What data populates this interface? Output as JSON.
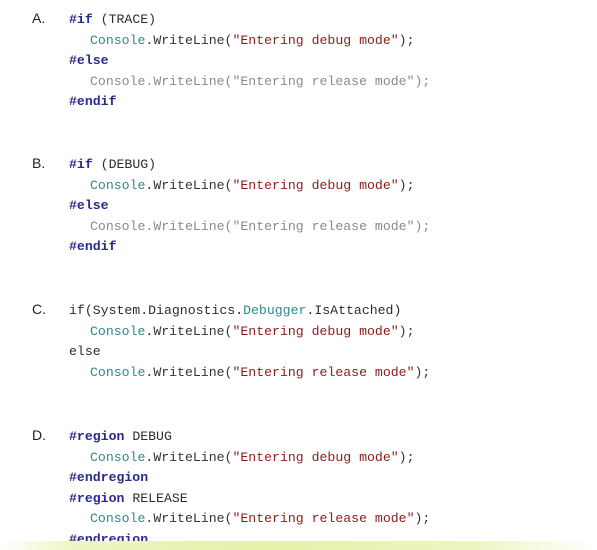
{
  "options": [
    {
      "letter": "A.",
      "lines": [
        {
          "indent": false,
          "parts": [
            {
              "t": "#if",
              "c": "dir"
            },
            {
              "t": " (TRACE)",
              "c": "plain"
            }
          ]
        },
        {
          "indent": true,
          "parts": [
            {
              "t": "Console",
              "c": "cls"
            },
            {
              "t": ".WriteLine(",
              "c": "mth"
            },
            {
              "t": "\"Entering debug mode\"",
              "c": "str"
            },
            {
              "t": ");",
              "c": "mth"
            }
          ]
        },
        {
          "indent": false,
          "parts": [
            {
              "t": "#else",
              "c": "dir"
            }
          ]
        },
        {
          "indent": true,
          "gray": true,
          "parts": [
            {
              "t": "Console",
              "c": "cls"
            },
            {
              "t": ".WriteLine(",
              "c": "mth"
            },
            {
              "t": "\"Entering release mode\"",
              "c": "str"
            },
            {
              "t": ");",
              "c": "mth"
            }
          ]
        },
        {
          "indent": false,
          "parts": [
            {
              "t": "#endif",
              "c": "dir"
            }
          ]
        }
      ]
    },
    {
      "letter": "B.",
      "lines": [
        {
          "indent": false,
          "parts": [
            {
              "t": "#if",
              "c": "dir"
            },
            {
              "t": " (DEBUG)",
              "c": "plain"
            }
          ]
        },
        {
          "indent": true,
          "parts": [
            {
              "t": "Console",
              "c": "cls"
            },
            {
              "t": ".WriteLine(",
              "c": "mth"
            },
            {
              "t": "\"Entering debug mode\"",
              "c": "str"
            },
            {
              "t": ");",
              "c": "mth"
            }
          ]
        },
        {
          "indent": false,
          "parts": [
            {
              "t": "#else",
              "c": "dir"
            }
          ]
        },
        {
          "indent": true,
          "gray": true,
          "parts": [
            {
              "t": "Console",
              "c": "cls"
            },
            {
              "t": ".WriteLine(",
              "c": "mth"
            },
            {
              "t": "\"Entering release mode\"",
              "c": "str"
            },
            {
              "t": ");",
              "c": "mth"
            }
          ]
        },
        {
          "indent": false,
          "parts": [
            {
              "t": "#endif",
              "c": "dir"
            }
          ]
        }
      ]
    },
    {
      "letter": "C.",
      "lines": [
        {
          "indent": false,
          "parts": [
            {
              "t": "if(System.Diagnostics.",
              "c": "plain"
            },
            {
              "t": "Debugger",
              "c": "cls"
            },
            {
              "t": ".IsAttached)",
              "c": "plain"
            }
          ]
        },
        {
          "indent": true,
          "parts": [
            {
              "t": "Console",
              "c": "cls"
            },
            {
              "t": ".WriteLine(",
              "c": "mth"
            },
            {
              "t": "\"Entering debug mode\"",
              "c": "str"
            },
            {
              "t": ");",
              "c": "mth"
            }
          ]
        },
        {
          "indent": false,
          "parts": [
            {
              "t": "else",
              "c": "plain"
            }
          ]
        },
        {
          "indent": true,
          "parts": [
            {
              "t": "Console",
              "c": "cls"
            },
            {
              "t": ".WriteLine(",
              "c": "mth"
            },
            {
              "t": "\"Entering release mode\"",
              "c": "str"
            },
            {
              "t": ");",
              "c": "mth"
            }
          ]
        }
      ]
    },
    {
      "letter": "D.",
      "lines": [
        {
          "indent": false,
          "parts": [
            {
              "t": "#region",
              "c": "dir"
            },
            {
              "t": " DEBUG",
              "c": "plain"
            }
          ]
        },
        {
          "indent": true,
          "parts": [
            {
              "t": "Console",
              "c": "cls"
            },
            {
              "t": ".WriteLine(",
              "c": "mth"
            },
            {
              "t": "\"Entering debug mode\"",
              "c": "str"
            },
            {
              "t": ");",
              "c": "mth"
            }
          ]
        },
        {
          "indent": false,
          "parts": [
            {
              "t": "#endregion",
              "c": "dir"
            }
          ]
        },
        {
          "indent": false,
          "parts": [
            {
              "t": "#region",
              "c": "dir"
            },
            {
              "t": " RELEASE",
              "c": "plain"
            }
          ]
        },
        {
          "indent": true,
          "parts": [
            {
              "t": "Console",
              "c": "cls"
            },
            {
              "t": ".WriteLine(",
              "c": "mth"
            },
            {
              "t": "\"Entering release mode\"",
              "c": "str"
            },
            {
              "t": ");",
              "c": "mth"
            }
          ]
        },
        {
          "indent": false,
          "parts": [
            {
              "t": "#endregion",
              "c": "dir"
            }
          ]
        }
      ]
    }
  ]
}
